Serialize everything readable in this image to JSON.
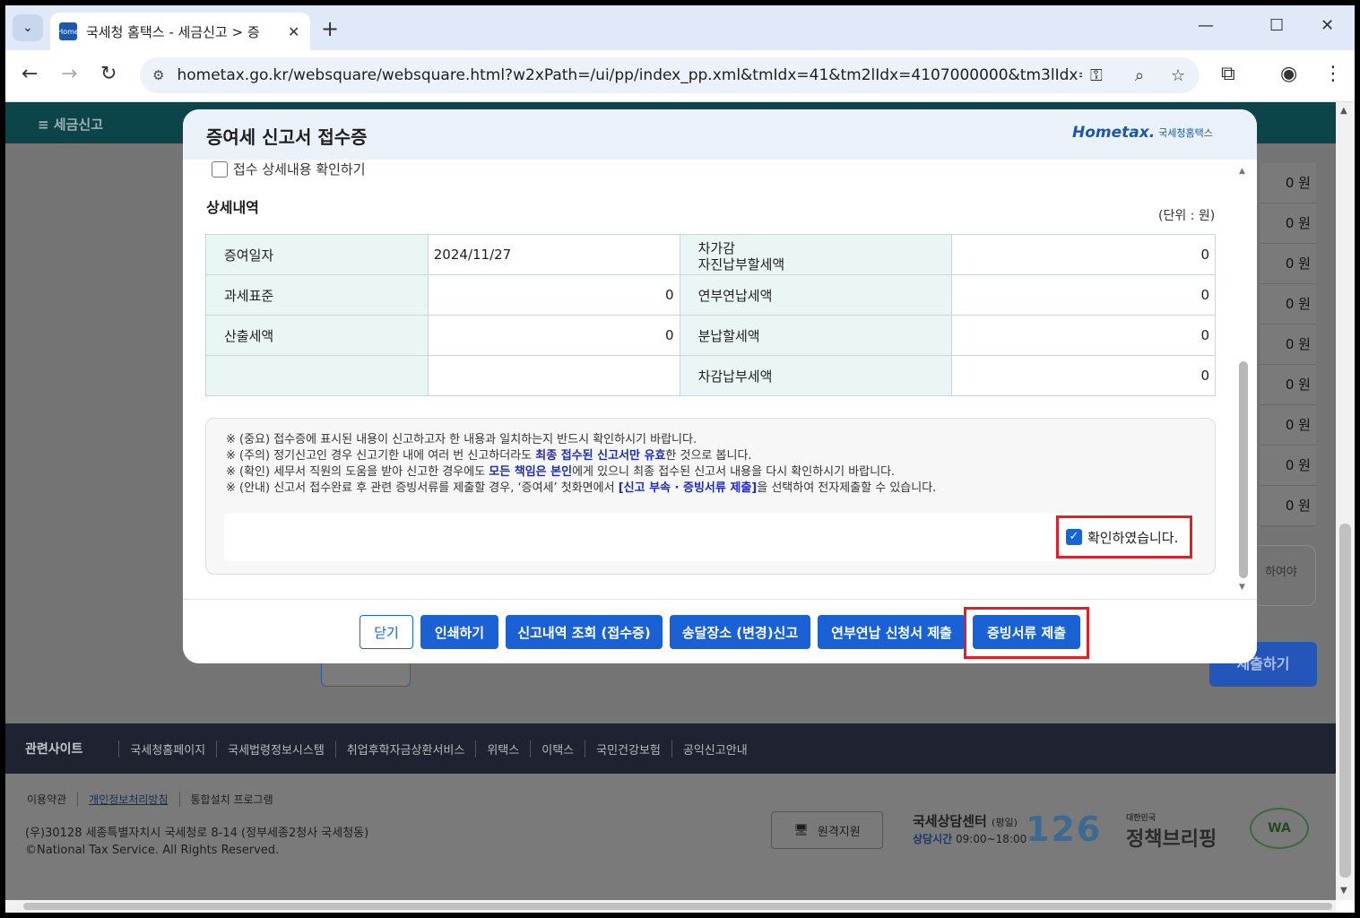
{
  "browser": {
    "tab_title": "국세청 홈택스 - 세금신고 > 증",
    "url": "hometax.go.kr/websquare/websquare.html?w2xPath=/ui/pp/index_pp.xml&tmIdx=41&tm2lIdx=4107000000&tm3lIdx=41070...",
    "favicon_text": "Home"
  },
  "page": {
    "menu_label": "≡  세금신고",
    "right_values": [
      "0 원",
      "0 원",
      "0 원",
      "0 원",
      "0 원",
      "0 원",
      "0 원",
      "0 원",
      "0 원"
    ],
    "side_text": "하여야",
    "submit_label": "제출하기"
  },
  "modal": {
    "title": "증여세 신고서 접수증",
    "logo_main": "Hometax.",
    "logo_sub": "국세청홈택스",
    "detail_check_label": "접수 상세내용 확인하기",
    "section_title": "상세내역",
    "unit": "(단위 : 원)",
    "table": {
      "row1": {
        "l_label": "증여일자",
        "l_value": "2024/11/27",
        "r_label_1": "차가감",
        "r_label_2": "자진납부할세액",
        "r_value": "0"
      },
      "row2": {
        "l_label": "과세표준",
        "l_value": "0",
        "r_label": "연부연납세액",
        "r_value": "0"
      },
      "row3": {
        "l_label": "산출세액",
        "l_value": "0",
        "r_label": "분납할세액",
        "r_value": "0"
      },
      "row4": {
        "l_label": "",
        "l_value": "",
        "r_label": "차감납부세액",
        "r_value": "0"
      }
    },
    "notice": {
      "line1": "※ (중요) 접수증에 표시된 내용이 신고하고자 한 내용과 일치하는지 반드시 확인하시기 바랍니다.",
      "line2_a": "※ (주의) 정기신고인 경우 신고기한 내에 여러 번 신고하더라도 ",
      "line2_b": "최종 접수된 신고서만 유효",
      "line2_c": "한 것으로 봅니다.",
      "line3_a": "※ (확인) 세무서 직원의 도움을 받아 신고한 경우에도 ",
      "line3_b": "모든 책임은 본인",
      "line3_c": "에게 있으니 최종 접수된 신고서 내용을 다시 확인하시기 바랍니다.",
      "line4_a": "※ (안내) 신고서 접수완료 후 관련 증빙서류를 제출할 경우, ‘증여세’ 첫화면에서 ",
      "line4_b": "[신고 부속 · 증빙서류 제출]",
      "line4_c": "을 선택하여 전자제출할 수 있습니다."
    },
    "confirm_label": "확인하였습니다.",
    "buttons": {
      "close": "닫기",
      "print": "인쇄하기",
      "history": "신고내역 조회 (접수증)",
      "address": "송달장소 (변경)신고",
      "installment": "연부연납 신청서 제출",
      "evidence": "증빙서류 제출"
    }
  },
  "footer": {
    "related_label": "관련사이트",
    "related_links": [
      "국세청홈페이지",
      "국세법령정보시스템",
      "취업후학자금상환서비스",
      "위택스",
      "이택스",
      "국민건강보험",
      "공익신고안내"
    ],
    "links": [
      "이용약관",
      "개인정보처리방침",
      "통합설치 프로그램"
    ],
    "address": "(우)30128 세종특별자치시 국세청로 8-14 (정부세종2청사 국세청동)",
    "copyright": "©National Tax Service. All Rights Reserved.",
    "remote_label": "원격지원",
    "center_title": "국세상담센터",
    "center_weekday": "(평일)",
    "center_hours_label": "상담시간",
    "center_hours": "09:00~18:00",
    "center_number": "126",
    "policy_small": "대한민국",
    "policy_main": "정책브리핑",
    "wa_logo": "WA"
  },
  "colors": {
    "primary": "#1a61d6",
    "highlight": "#e01e26",
    "nav": "#0b4549"
  }
}
